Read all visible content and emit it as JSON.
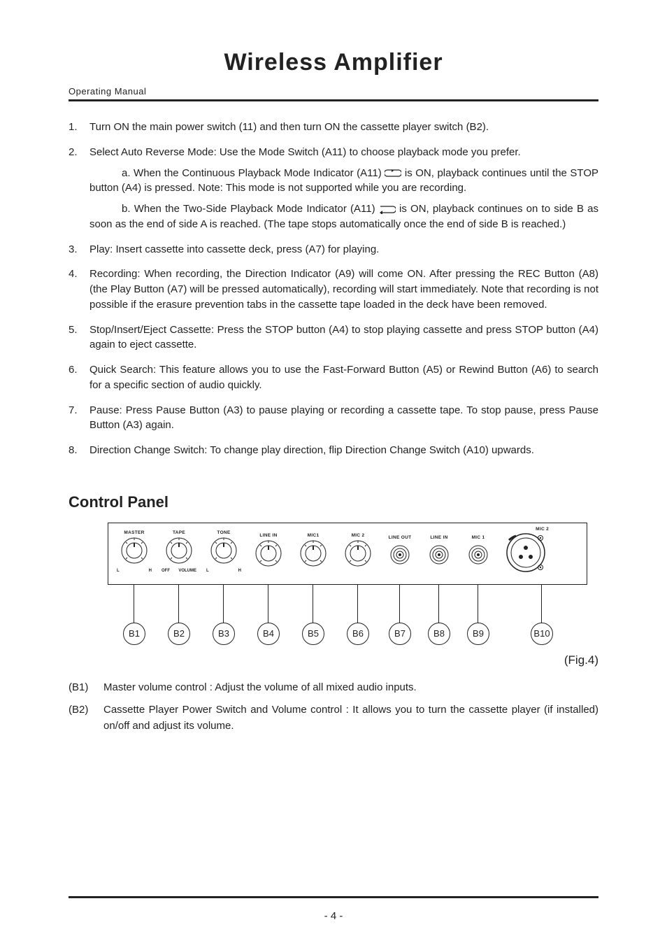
{
  "doc": {
    "title": "Wireless  Amplifier",
    "subhead": "Operating  Manual",
    "page_num": "- 4 -"
  },
  "list": {
    "i1": {
      "n": "1.",
      "t": "Turn ON the main power switch (11) and then turn ON the cassette player switch (B2)."
    },
    "i2": {
      "n": "2.",
      "t": "Select Auto Reverse Mode: Use the Mode Switch (A11) to choose playback mode you prefer."
    },
    "i2a_pre": "a.  When  the  Continuous  Playback  Mode  Indicator  (A11) ",
    "i2a_post": "  is  ON,  playback continues until the STOP button (A4) is pressed.  Note: This mode is not supported while you are recording.",
    "i2b_pre": "b.  When  the  Two-Side  Playback  Mode  Indicator  (A11)  ",
    "i2b_post": "   is  ON,  playback continues on to side B as soon as the end of side A is reached. (The tape stops automatically once the end of side B is reached.)",
    "i3": {
      "n": "3.",
      "t": "Play: Insert cassette into cassette deck, press (A7) for playing."
    },
    "i4": {
      "n": "4.",
      "t": "Recording: When recording, the Direction Indicator (A9) will come ON.  After pressing the REC Button (A8) (the Play Button (A7) will be pressed automatically), recording will start immediately.  Note that recording is not possible if the erasure prevention tabs in the cassette tape loaded in the deck have been removed."
    },
    "i5": {
      "n": "5.",
      "t": "Stop/Insert/Eject Cassette: Press the STOP button (A4) to stop playing cassette and press STOP button (A4) again to eject cassette."
    },
    "i6": {
      "n": "6.",
      "t": "Quick Search: This feature allows you to use the Fast-Forward Button (A5) or Rewind Button (A6) to search for a specific section of audio quickly."
    },
    "i7": {
      "n": "7.",
      "t": "Pause: Press Pause Button (A3) to pause playing or recording a cassette tape.  To stop pause, press Pause Button (A3) again."
    },
    "i8": {
      "n": "8.",
      "t": "Direction Change Switch: To change play direction, flip Direction Change Switch (A10)  upwards."
    }
  },
  "section": {
    "title": "Control  Panel",
    "fig": "(Fig.4)"
  },
  "panel": {
    "k1": {
      "top": "MASTER",
      "l": "L",
      "r": "H"
    },
    "k2": {
      "top": "TAPE",
      "l": "OFF",
      "r": "VOLUME"
    },
    "k3": {
      "top": "TONE",
      "l": "L",
      "r": "H"
    },
    "k4": {
      "top": "LINE IN"
    },
    "k5": {
      "top": "MIC1"
    },
    "k6": {
      "top": "MIC 2"
    },
    "j7": {
      "top": "LINE OUT"
    },
    "j8": {
      "top": "LINE IN"
    },
    "j9": {
      "top": "MIC 1"
    },
    "t10": {
      "top": "MIC 2"
    }
  },
  "callouts": {
    "b1": "B1",
    "b2": "B2",
    "b3": "B3",
    "b4": "B4",
    "b5": "B5",
    "b6": "B6",
    "b7": "B7",
    "b8": "B8",
    "b9": "B9",
    "b10": "B10"
  },
  "desc": {
    "d1": {
      "tag": "(B1)",
      "t": "Master volume control : Adjust the volume of all mixed audio inputs."
    },
    "d2": {
      "tag": "(B2)",
      "t": "Cassette Player Power Switch and Volume control : It allows you to turn the cassette player (if installed) on/off and adjust its volume."
    }
  }
}
